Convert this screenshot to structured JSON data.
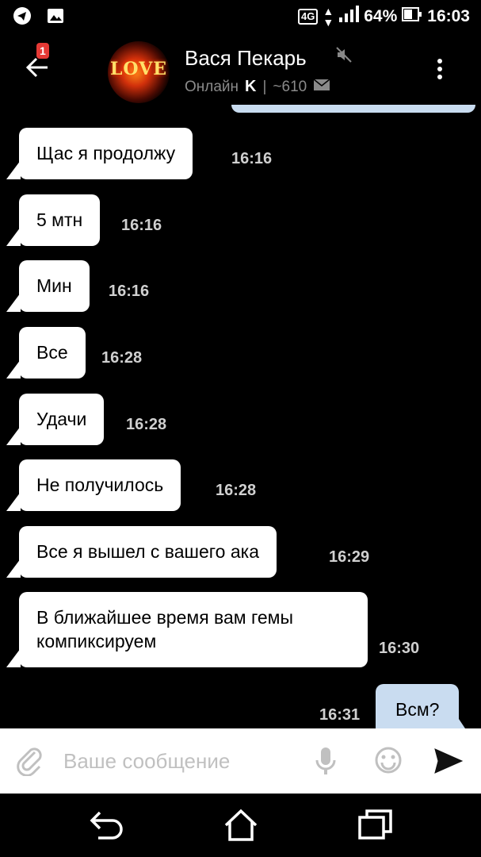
{
  "status_bar": {
    "network": "4G",
    "battery": "64%",
    "time": "16:03",
    "icons": [
      "telegram-icon",
      "gallery-icon",
      "signal-icon",
      "battery-icon"
    ]
  },
  "header": {
    "back_badge": "1",
    "avatar_text": "LOVE",
    "title": "Вася Пекарь",
    "status": "Онлайн",
    "brand_letter": "K",
    "separator": "|",
    "count": "~610"
  },
  "messages": [
    {
      "text": "Щас я продолжу",
      "time": "16:16",
      "direction": "in"
    },
    {
      "text": "5 мтн",
      "time": "16:16",
      "direction": "in"
    },
    {
      "text": "Мин",
      "time": "16:16",
      "direction": "in"
    },
    {
      "text": "Все",
      "time": "16:28",
      "direction": "in"
    },
    {
      "text": "Удачи",
      "time": "16:28",
      "direction": "in"
    },
    {
      "text": "Не получилось",
      "time": "16:28",
      "direction": "in"
    },
    {
      "text": "Все я вышел с вашего ака",
      "time": "16:29",
      "direction": "in"
    },
    {
      "text": "В ближайшее время вам гемы\nкомпиксируем",
      "time": "16:30",
      "direction": "in"
    },
    {
      "text": "Всм?",
      "time": "16:31",
      "direction": "out"
    }
  ],
  "input": {
    "placeholder": "Ваше сообщение"
  },
  "colors": {
    "background": "#000000",
    "incoming_bubble": "#ffffff",
    "outgoing_bubble": "#c9dcf0",
    "badge": "#e53935"
  }
}
